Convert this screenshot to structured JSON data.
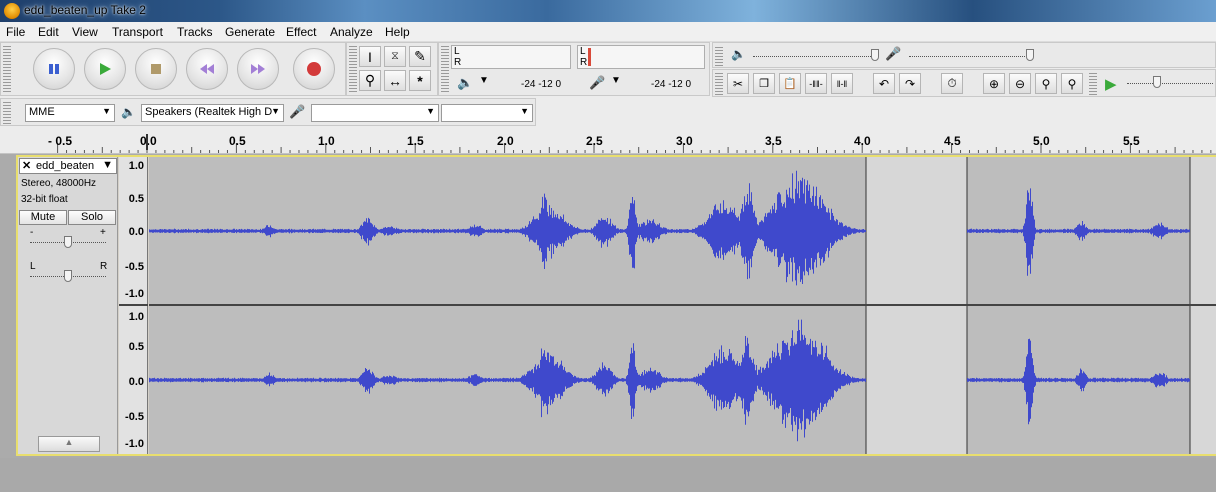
{
  "window": {
    "title": "edd_beaten_up Take 2"
  },
  "menu": [
    "File",
    "Edit",
    "View",
    "Transport",
    "Tracks",
    "Generate",
    "Effect",
    "Analyze",
    "Help"
  ],
  "meters": {
    "record_left": "L",
    "record_right": "R",
    "play_left": "L",
    "play_right": "R",
    "scale_a": "-24  -12  0",
    "scale_b": "-24  -12  0"
  },
  "device": {
    "host": "MME",
    "output": "Speakers (Realtek High D",
    "input": "",
    "channels": ""
  },
  "ruler": {
    "labels": [
      "- 0.5",
      "0.0",
      "0.5",
      "1.0",
      "1.5",
      "2.0",
      "2.5",
      "3.0",
      "3.5",
      "4.0",
      "4.5",
      "5.0",
      "5.5"
    ]
  },
  "track": {
    "name": "edd_beaten",
    "format": "Stereo, 48000Hz",
    "bitdepth": "32-bit float",
    "mute": "Mute",
    "solo": "Solo",
    "gain_minus": "-",
    "gain_plus": "+",
    "pan_left": "L",
    "pan_right": "R",
    "collapse": "▲",
    "close": "✕",
    "menu_arrow": "▼",
    "scale_top": [
      "1.0",
      "0.5",
      "0.0",
      "-0.5",
      "-1.0"
    ],
    "scale_bottom": [
      "1.0",
      "0.5",
      "0.0",
      "-0.5",
      "-1.0"
    ]
  },
  "colors": {
    "wave": "#3f49cc",
    "wave_bg": "#bdbdbd",
    "gap_bg": "#d7d7d7",
    "track_border": "#e8de6e"
  }
}
